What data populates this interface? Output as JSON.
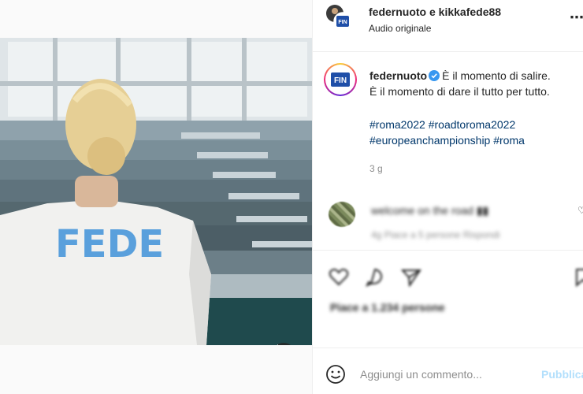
{
  "post": {
    "header": {
      "title": "federnuoto e kikkafede88",
      "subtitle": "Audio originale",
      "more_icon": "more-horizontal-icon",
      "logo_text": "FIN"
    },
    "media": {
      "shirt_text": "FEDE",
      "mute_icon": "speaker-icon"
    },
    "caption": {
      "username": "federnuoto",
      "line1": "È il momento di salire.",
      "line2": "È il momento di dare il tutto per tutto.",
      "hashtags": [
        "#roma2022",
        "#roadtoroma2022",
        "#europeanchampionship",
        "#roma"
      ],
      "age": "3 g",
      "verified_color": "#3897f0"
    },
    "comment": {
      "text": "welcome on the road ▮▮",
      "meta": "4g   Piace a 5 persone   Rispondi"
    },
    "actions": {
      "icons": [
        "heart-icon",
        "comment-icon",
        "share-icon",
        "bookmark-icon"
      ],
      "likes": "Piace a 1.234 persone"
    },
    "add_comment": {
      "placeholder": "Aggiungi un commento...",
      "publish_label": "Pubblica",
      "emoji_icon": "emoji-icon"
    },
    "colors": {
      "link": "#00376b",
      "muted": "#8e8e8e",
      "publish_disabled": "#b2dffc",
      "shirt_text": "#5aa0dc"
    }
  }
}
